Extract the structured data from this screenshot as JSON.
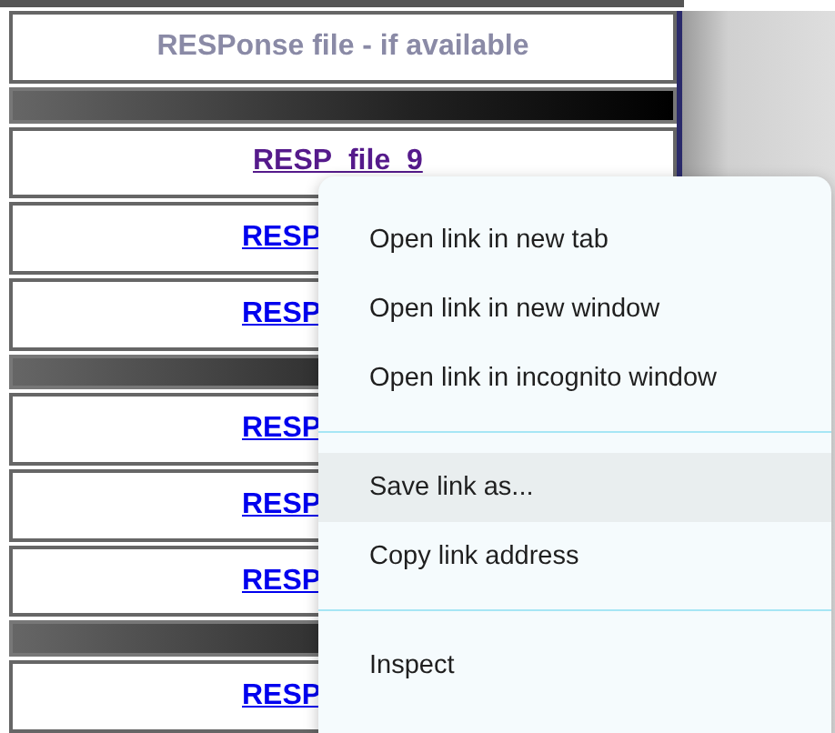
{
  "table": {
    "header": "RESPonse file - if available",
    "rows": [
      {
        "kind": "divider"
      },
      {
        "kind": "link",
        "text": "RESP_file_9",
        "visited": true
      },
      {
        "kind": "link",
        "text": "RESP",
        "visited": false
      },
      {
        "kind": "link",
        "text": "RESP",
        "visited": false
      },
      {
        "kind": "divider"
      },
      {
        "kind": "link",
        "text": "RESP",
        "visited": false
      },
      {
        "kind": "link",
        "text": "RESP",
        "visited": false
      },
      {
        "kind": "link",
        "text": "RESP",
        "visited": false
      },
      {
        "kind": "divider"
      },
      {
        "kind": "link",
        "text": "RESP",
        "visited": false
      }
    ]
  },
  "context_menu": {
    "items": [
      {
        "kind": "item",
        "label": "Open link in new tab",
        "selected": false
      },
      {
        "kind": "item",
        "label": "Open link in new window",
        "selected": false
      },
      {
        "kind": "item",
        "label": "Open link in incognito window",
        "selected": false
      },
      {
        "kind": "separator"
      },
      {
        "kind": "item",
        "label": "Save link as...",
        "selected": true
      },
      {
        "kind": "item",
        "label": "Copy link address",
        "selected": false
      },
      {
        "kind": "separator"
      },
      {
        "kind": "item",
        "label": "Inspect",
        "selected": false
      }
    ]
  }
}
